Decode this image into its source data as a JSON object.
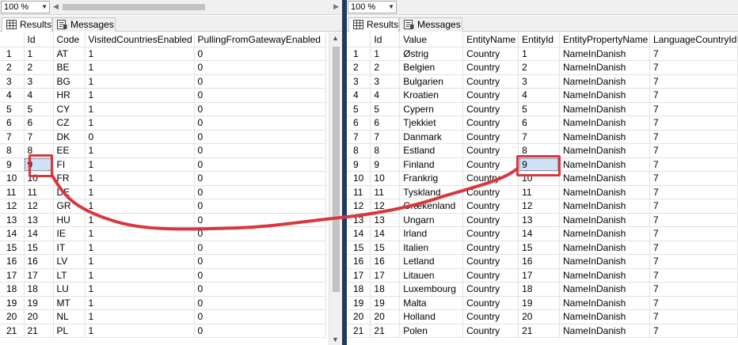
{
  "left": {
    "zoom": "100 %",
    "tabs": {
      "results": "Results",
      "messages": "Messages"
    },
    "columns": [
      "",
      "Id",
      "Code",
      "VisitedCountriesEnabled",
      "PullingFromGatewayEnabled"
    ],
    "rows": [
      [
        "1",
        "1",
        "AT",
        "1",
        "0"
      ],
      [
        "2",
        "2",
        "BE",
        "1",
        "0"
      ],
      [
        "3",
        "3",
        "BG",
        "1",
        "0"
      ],
      [
        "4",
        "4",
        "HR",
        "1",
        "0"
      ],
      [
        "5",
        "5",
        "CY",
        "1",
        "0"
      ],
      [
        "6",
        "6",
        "CZ",
        "1",
        "0"
      ],
      [
        "7",
        "7",
        "DK",
        "0",
        "0"
      ],
      [
        "8",
        "8",
        "EE",
        "1",
        "0"
      ],
      [
        "9",
        "9",
        "FI",
        "1",
        "0"
      ],
      [
        "10",
        "10",
        "FR",
        "1",
        "0"
      ],
      [
        "11",
        "11",
        "DE",
        "1",
        "0"
      ],
      [
        "12",
        "12",
        "GR",
        "1",
        "0"
      ],
      [
        "13",
        "13",
        "HU",
        "1",
        "0"
      ],
      [
        "14",
        "14",
        "IE",
        "1",
        "0"
      ],
      [
        "15",
        "15",
        "IT",
        "1",
        "0"
      ],
      [
        "16",
        "16",
        "LV",
        "1",
        "0"
      ],
      [
        "17",
        "17",
        "LT",
        "1",
        "0"
      ],
      [
        "18",
        "18",
        "LU",
        "1",
        "0"
      ],
      [
        "19",
        "19",
        "MT",
        "1",
        "0"
      ],
      [
        "20",
        "20",
        "NL",
        "1",
        "0"
      ],
      [
        "21",
        "21",
        "PL",
        "1",
        "0"
      ]
    ]
  },
  "right": {
    "zoom": "100 %",
    "tabs": {
      "results": "Results",
      "messages": "Messages"
    },
    "columns": [
      "",
      "Id",
      "Value",
      "EntityName",
      "EntityId",
      "EntityPropertyName",
      "LanguageCountryId"
    ],
    "rows": [
      [
        "1",
        "1",
        "Østrig",
        "Country",
        "1",
        "NameInDanish",
        "7"
      ],
      [
        "2",
        "2",
        "Belgien",
        "Country",
        "2",
        "NameInDanish",
        "7"
      ],
      [
        "3",
        "3",
        "Bulgarien",
        "Country",
        "3",
        "NameInDanish",
        "7"
      ],
      [
        "4",
        "4",
        "Kroatien",
        "Country",
        "4",
        "NameInDanish",
        "7"
      ],
      [
        "5",
        "5",
        "Cypern",
        "Country",
        "5",
        "NameInDanish",
        "7"
      ],
      [
        "6",
        "6",
        "Tjekkiet",
        "Country",
        "6",
        "NameInDanish",
        "7"
      ],
      [
        "7",
        "7",
        "Danmark",
        "Country",
        "7",
        "NameInDanish",
        "7"
      ],
      [
        "8",
        "8",
        "Estland",
        "Country",
        "8",
        "NameInDanish",
        "7"
      ],
      [
        "9",
        "9",
        "Finland",
        "Country",
        "9",
        "NameInDanish",
        "7"
      ],
      [
        "10",
        "10",
        "Frankrig",
        "Country",
        "10",
        "NameInDanish",
        "7"
      ],
      [
        "11",
        "11",
        "Tyskland",
        "Country",
        "11",
        "NameInDanish",
        "7"
      ],
      [
        "12",
        "12",
        "Grækenland",
        "Country",
        "12",
        "NameInDanish",
        "7"
      ],
      [
        "13",
        "13",
        "Ungarn",
        "Country",
        "13",
        "NameInDanish",
        "7"
      ],
      [
        "14",
        "14",
        "Irland",
        "Country",
        "14",
        "NameInDanish",
        "7"
      ],
      [
        "15",
        "15",
        "Italien",
        "Country",
        "15",
        "NameInDanish",
        "7"
      ],
      [
        "16",
        "16",
        "Letland",
        "Country",
        "16",
        "NameInDanish",
        "7"
      ],
      [
        "17",
        "17",
        "Litauen",
        "Country",
        "17",
        "NameInDanish",
        "7"
      ],
      [
        "18",
        "18",
        "Luxembourg",
        "Country",
        "18",
        "NameInDanish",
        "7"
      ],
      [
        "19",
        "19",
        "Malta",
        "Country",
        "19",
        "NameInDanish",
        "7"
      ],
      [
        "20",
        "20",
        "Holland",
        "Country",
        "20",
        "NameInDanish",
        "7"
      ],
      [
        "21",
        "21",
        "Polen",
        "Country",
        "21",
        "NameInDanish",
        "7"
      ]
    ]
  },
  "colors": {
    "annotation": "#d9373f",
    "selection": "#cfe2f7",
    "splitter": "#1e3a5f"
  },
  "icons": {
    "results": "grid-icon",
    "messages": "messages-icon",
    "dropdown": "chevron-down-icon"
  }
}
